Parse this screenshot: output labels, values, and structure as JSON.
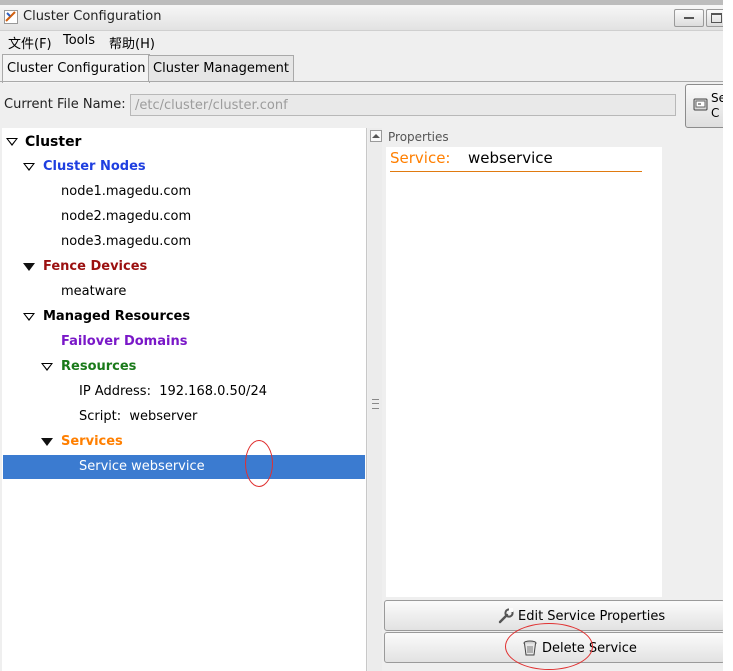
{
  "window": {
    "title": "Cluster Configuration"
  },
  "menu": [
    {
      "label": "文件(F)"
    },
    {
      "label": "Tools"
    },
    {
      "label": "帮助(H)"
    }
  ],
  "tabs": [
    {
      "label": "Cluster Configuration",
      "active": true
    },
    {
      "label": "Cluster Management",
      "active": false
    }
  ],
  "file": {
    "label": "Current File Name:",
    "value": "/etc/cluster/cluster.conf",
    "save_button_label": "Se\nC"
  },
  "tree": {
    "root": "Cluster",
    "cluster_nodes": {
      "label": "Cluster Nodes",
      "items": [
        "node1.magedu.com",
        "node2.magedu.com",
        "node3.magedu.com"
      ]
    },
    "fence_devices": {
      "label": "Fence Devices",
      "items": [
        "meatware"
      ]
    },
    "managed_resources": {
      "label": "Managed Resources",
      "failover_domains": "Failover Domains",
      "resources": {
        "label": "Resources",
        "items": [
          "IP Address:  192.168.0.50/24",
          "Script:  webserver"
        ]
      },
      "services": {
        "label": "Services",
        "items": [
          "Service webservice"
        ]
      }
    }
  },
  "properties": {
    "legend": "Properties",
    "key": "Service:",
    "value": "webservice"
  },
  "actions": {
    "edit": "Edit Service Properties",
    "delete": "Delete Service"
  },
  "colors": {
    "cluster_nodes": "#1f3fe0",
    "fence_devices": "#9b1010",
    "failover_domains": "#7a18c8",
    "resources": "#1a7a1a",
    "services": "#ff7f00",
    "selection": "#3b7bd0"
  }
}
